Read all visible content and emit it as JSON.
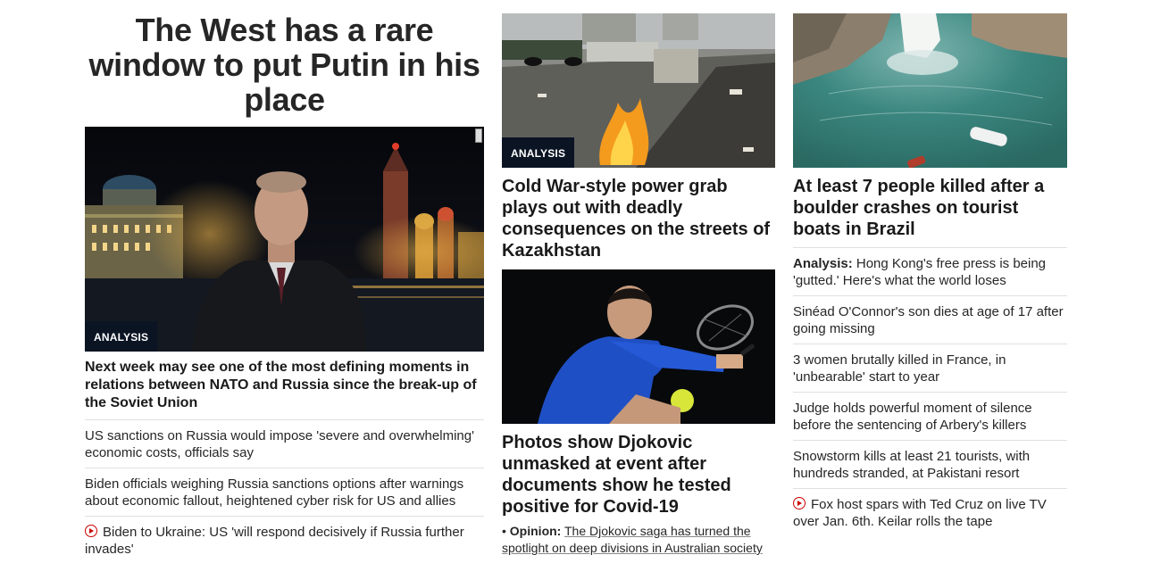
{
  "col1": {
    "headline": "The West has a rare window to put Putin in his place",
    "badge": "ANALYSIS",
    "lead": "Next week may see one of the most defining moments in relations between NATO and Russia since the break-up of the Soviet Union",
    "stories": [
      {
        "text": "US sanctions on Russia would impose 'severe and overwhelming' economic costs, officials say"
      },
      {
        "text": "Biden officials weighing Russia sanctions options after warnings about economic fallout, heightened cyber risk for US and allies"
      },
      {
        "text": "Biden to Ukraine: US 'will respond decisively if Russia further invades'",
        "icon": "play-icon"
      }
    ]
  },
  "col2": {
    "story1": {
      "badge": "ANALYSIS",
      "title": "Cold War-style power grab plays out with deadly consequences on the streets of Kazakhstan"
    },
    "story2": {
      "title": "Photos show Djokovic unmasked at event after documents show he tested positive for Covid-19",
      "opinion_label": "Opinion:",
      "opinion_text": "The Djokovic saga has turned the spotlight on deep divisions in Australian society",
      "bullet": "•"
    }
  },
  "col3": {
    "title": "At least 7 people killed after a boulder crashes on tourist boats in Brazil",
    "stories": [
      {
        "label": "Analysis:",
        "text": "Hong Kong's free press is being 'gutted.' Here's what the world loses"
      },
      {
        "text": "Sinéad O'Connor's son dies at age of 17 after going missing"
      },
      {
        "text": "3 women brutally killed in France, in 'unbearable' start to year"
      },
      {
        "text": "Judge holds powerful moment of silence before the sentencing of Arbery's killers"
      },
      {
        "text": "Snowstorm kills at least 21 tourists, with hundreds stranded, at Pakistani resort"
      },
      {
        "text": "Fox host spars with Ted Cruz on live TV over Jan. 6th. Keilar rolls the tape",
        "icon": "play-icon"
      }
    ]
  },
  "colors": {
    "badge_bg": "#0b1423",
    "video_icon": "#cc0000",
    "divider": "#e0e0e0"
  }
}
